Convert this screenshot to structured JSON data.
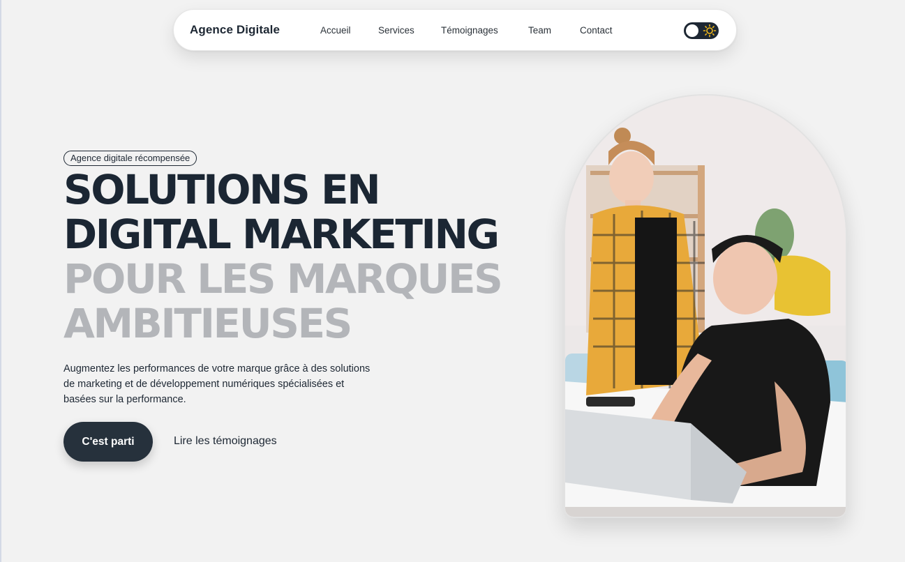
{
  "nav": {
    "brand": "Agence Digitale",
    "links": [
      "Accueil",
      "Services",
      "Témoignages",
      "Team",
      "Contact"
    ],
    "theme_toggle": {
      "state": "off",
      "icon": "sun-icon"
    }
  },
  "hero": {
    "badge": "Agence digitale récompensée",
    "headline_dark": [
      "SOLUTIONS EN",
      "DIGITAL MARKETING"
    ],
    "headline_grey": [
      "POUR LES MARQUES",
      "AMBITIEUSES"
    ],
    "description": "Augmentez les performances de votre marque grâce à des solutions de marketing et de développement numériques spécialisées et basées sur la performance.",
    "primary_cta": "C'est parti",
    "secondary_cta": "Lire les témoignages",
    "image": "photo of two people working at a laptop"
  },
  "colors": {
    "background": "#f2f2f2",
    "dark": "#1b2633",
    "grey_text": "#b3b5b9",
    "button": "#26313c",
    "sun": "#f2b91a"
  }
}
